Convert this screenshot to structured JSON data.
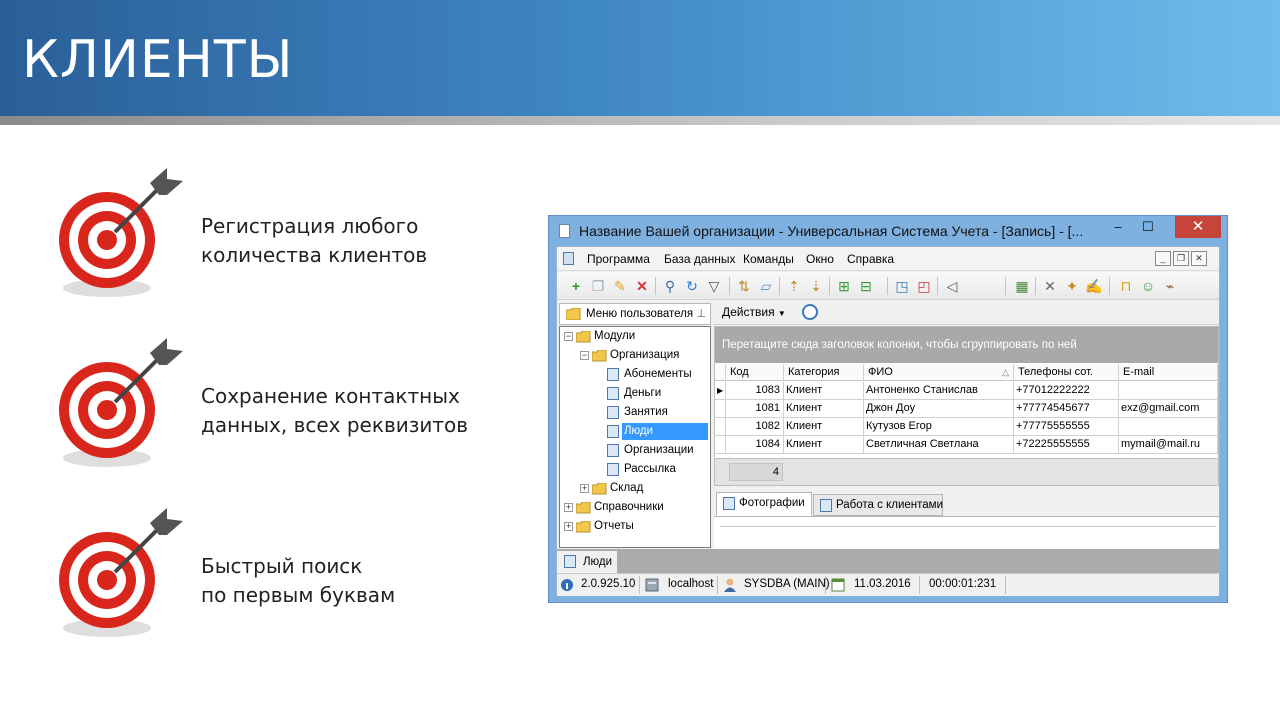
{
  "slide": {
    "title": "КЛИЕНТЫ",
    "features": [
      {
        "line1": "Регистрация любого",
        "line2": "количества клиентов"
      },
      {
        "line1": "Сохранение контактных",
        "line2": "данных, всех реквизитов"
      },
      {
        "line1": "Быстрый поиск",
        "line2": "по первым буквам"
      }
    ]
  },
  "window": {
    "title": "Название Вашей организации - Универсальная Система Учета - [Запись] - [...",
    "controls": {
      "minimize": "–",
      "maximize": "☐",
      "close": "✕"
    },
    "menu": [
      "Программа",
      "База данных",
      "Команды",
      "Окно",
      "Справка"
    ],
    "mdi_controls": [
      "_",
      "❐",
      "✕"
    ],
    "toolbar_icons": [
      "add-icon",
      "copy-icon",
      "edit-icon",
      "delete-icon",
      "search-icon",
      "refresh-icon",
      "filter-icon",
      "sort-icon",
      "comment-icon",
      "tree-up-icon",
      "tree-down-icon",
      "export-icon",
      "import-icon",
      "new-window-icon",
      "close-window-icon",
      "speaker-icon",
      "calendar-icon",
      "tools-icon",
      "magic-icon",
      "edit-doc-icon",
      "lock-icon",
      "users-icon",
      "plug-icon"
    ],
    "user_menu": {
      "header": "Меню пользователя",
      "pin": "⊥",
      "tree": [
        {
          "label": "Модули",
          "level": 0,
          "type": "folder",
          "expanded": true
        },
        {
          "label": "Организация",
          "level": 1,
          "type": "folder",
          "expanded": true
        },
        {
          "label": "Абонементы",
          "level": 2,
          "type": "doc"
        },
        {
          "label": "Деньги",
          "level": 2,
          "type": "doc"
        },
        {
          "label": "Занятия",
          "level": 2,
          "type": "doc"
        },
        {
          "label": "Люди",
          "level": 2,
          "type": "doc",
          "selected": true
        },
        {
          "label": "Организации",
          "level": 2,
          "type": "doc"
        },
        {
          "label": "Рассылка",
          "level": 2,
          "type": "doc"
        },
        {
          "label": "Склад",
          "level": 1,
          "type": "folder",
          "expanded": false
        },
        {
          "label": "Справочники",
          "level": 0,
          "type": "folder",
          "expanded": false
        },
        {
          "label": "Отчеты",
          "level": 0,
          "type": "folder",
          "expanded": false
        }
      ]
    },
    "actions_label": "Действия",
    "group_hint": "Перетащите сюда заголовок колонки, чтобы сгруппировать по ней",
    "grid": {
      "columns": [
        "Код",
        "Категория",
        "ФИО",
        "Телефоны сот.",
        "E-mail"
      ],
      "sort_indicator": "△",
      "rows": [
        [
          "1083",
          "Клиент",
          "Антоненко Станислав",
          "+77012222222",
          ""
        ],
        [
          "1081",
          "Клиент",
          "Джон Доу",
          "+77774545677",
          "exz@gmail.com"
        ],
        [
          "1082",
          "Клиент",
          "Кутузов Егор",
          "+77775555555",
          ""
        ],
        [
          "1084",
          "Клиент",
          "Светличная Светлана",
          "+72225555555",
          "mymail@mail.ru"
        ]
      ],
      "current_row_marker": "▶",
      "count": "4"
    },
    "detail_tabs": [
      "Фотографии",
      "Работа с клиентами"
    ],
    "bottom_tab": "Люди",
    "status": {
      "version": "2.0.925.10",
      "server": "localhost",
      "user": "SYSDBA (MAIN)",
      "date": "11.03.2016",
      "timer": "00:00:01:231"
    }
  }
}
